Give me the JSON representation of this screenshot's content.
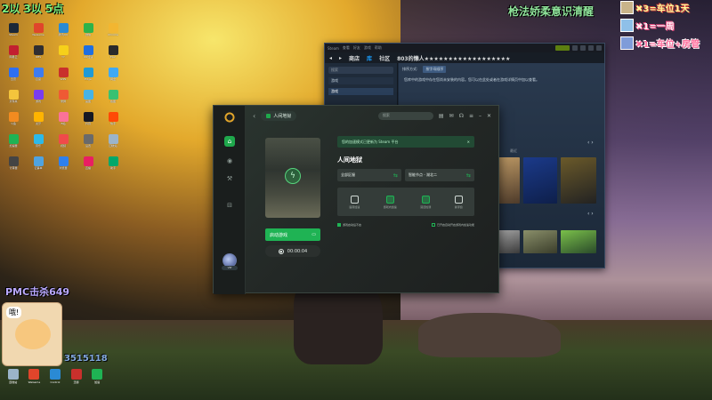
{
  "overlay": {
    "top_left": "2以 3以 5点",
    "fps": "PMC击杀649",
    "id_text": "3515118",
    "scrolling_text": "枪法娇柔意识清醒",
    "rules": [
      "✖3=车位1天",
      "✖1=一周",
      "✖1=车位+房管"
    ],
    "cat_bubble": "哦!"
  },
  "desktop_icons": [
    {
      "label": "Steam",
      "color": "#1b2838"
    },
    {
      "label": "WeGame",
      "color": "#e0452b"
    },
    {
      "label": "腾讯QQ",
      "color": "#2a8ad4"
    },
    {
      "label": "微信",
      "color": "#2cb34a"
    },
    {
      "label": "Chrome",
      "color": "#f2b631"
    },
    {
      "label": "网易云",
      "color": "#c21f30"
    },
    {
      "label": "OBS",
      "color": "#302e31"
    },
    {
      "label": "YY",
      "color": "#f6d01a"
    },
    {
      "label": "UU加速",
      "color": "#1f6fe0"
    },
    {
      "label": "Epic",
      "color": "#2b2b2b"
    },
    {
      "label": "迅雷",
      "color": "#2e6ff0"
    },
    {
      "label": "百度",
      "color": "#3d7cf0"
    },
    {
      "label": "WPS",
      "color": "#c9302c"
    },
    {
      "label": "Edge",
      "color": "#1f9ad6"
    },
    {
      "label": "网盘",
      "color": "#3fa9f5"
    },
    {
      "label": "文件夹",
      "color": "#f3c43c"
    },
    {
      "label": "游戏",
      "color": "#7a3df0"
    },
    {
      "label": "录屏",
      "color": "#ef5a34"
    },
    {
      "label": "画图",
      "color": "#46b3e6"
    },
    {
      "label": "截图",
      "color": "#38c172"
    },
    {
      "label": "斗鱼",
      "color": "#f28b20"
    },
    {
      "label": "虎牙",
      "color": "#ffb400"
    },
    {
      "label": "B站",
      "color": "#fb7299"
    },
    {
      "label": "抖音",
      "color": "#161823"
    },
    {
      "label": "快手",
      "color": "#ff4906"
    },
    {
      "label": "加速器",
      "color": "#1fb354"
    },
    {
      "label": "音乐",
      "color": "#2db9e8"
    },
    {
      "label": "视频",
      "color": "#f04a4a"
    },
    {
      "label": "设置",
      "color": "#6a6a6a"
    },
    {
      "label": "回收站",
      "color": "#9bb4c9"
    },
    {
      "label": "计算器",
      "color": "#444"
    },
    {
      "label": "记事本",
      "color": "#4fa3e0"
    },
    {
      "label": "浏览器",
      "color": "#2f80ed"
    },
    {
      "label": "直播",
      "color": "#e91e63"
    },
    {
      "label": "助手",
      "color": "#00a86b"
    }
  ],
  "taskbar": [
    {
      "label": "回收站",
      "color": "#9bb4c9"
    },
    {
      "label": "WeGame",
      "color": "#e0452b"
    },
    {
      "label": "Control",
      "color": "#2a8ad4"
    },
    {
      "label": "迅游",
      "color": "#c9302c"
    },
    {
      "label": "加速",
      "color": "#1fb354"
    }
  ],
  "steam": {
    "menu": [
      "Steam",
      "查看",
      "好友",
      "游戏",
      "帮助"
    ],
    "nav": [
      "商店",
      "库",
      "社区",
      "803的懒人★★★★★★★★★★★★★★★★★★"
    ],
    "search_placeholder": "搜索",
    "filter_label": "游戏",
    "games_label": "游戏",
    "sort_label": "排序方式:",
    "sort_value": "按字母顺序",
    "message": "您库中的游戏中存在您尚未安装的内容。您可以在此处或者在游戏详情页中加以查看。",
    "row_label": "最近"
  },
  "booster": {
    "tab_label": "人间地狱",
    "search_placeholder": "搜索",
    "notice": "您的加速模式已更新为 Steam 平台",
    "game_title": "人间地狱",
    "server_dropdown": "全部区服",
    "node_dropdown": "智能节点 - 湖北二",
    "tools": [
      "语音加速",
      "游戏内加速",
      "延迟检测",
      "悬浮窗"
    ],
    "option1": "游戏启动后不启",
    "option2": "已开启自动开启游戏内加速功能",
    "start_label": "启动游戏",
    "timer": "00:00:04",
    "avatar_tag": "VIP"
  }
}
